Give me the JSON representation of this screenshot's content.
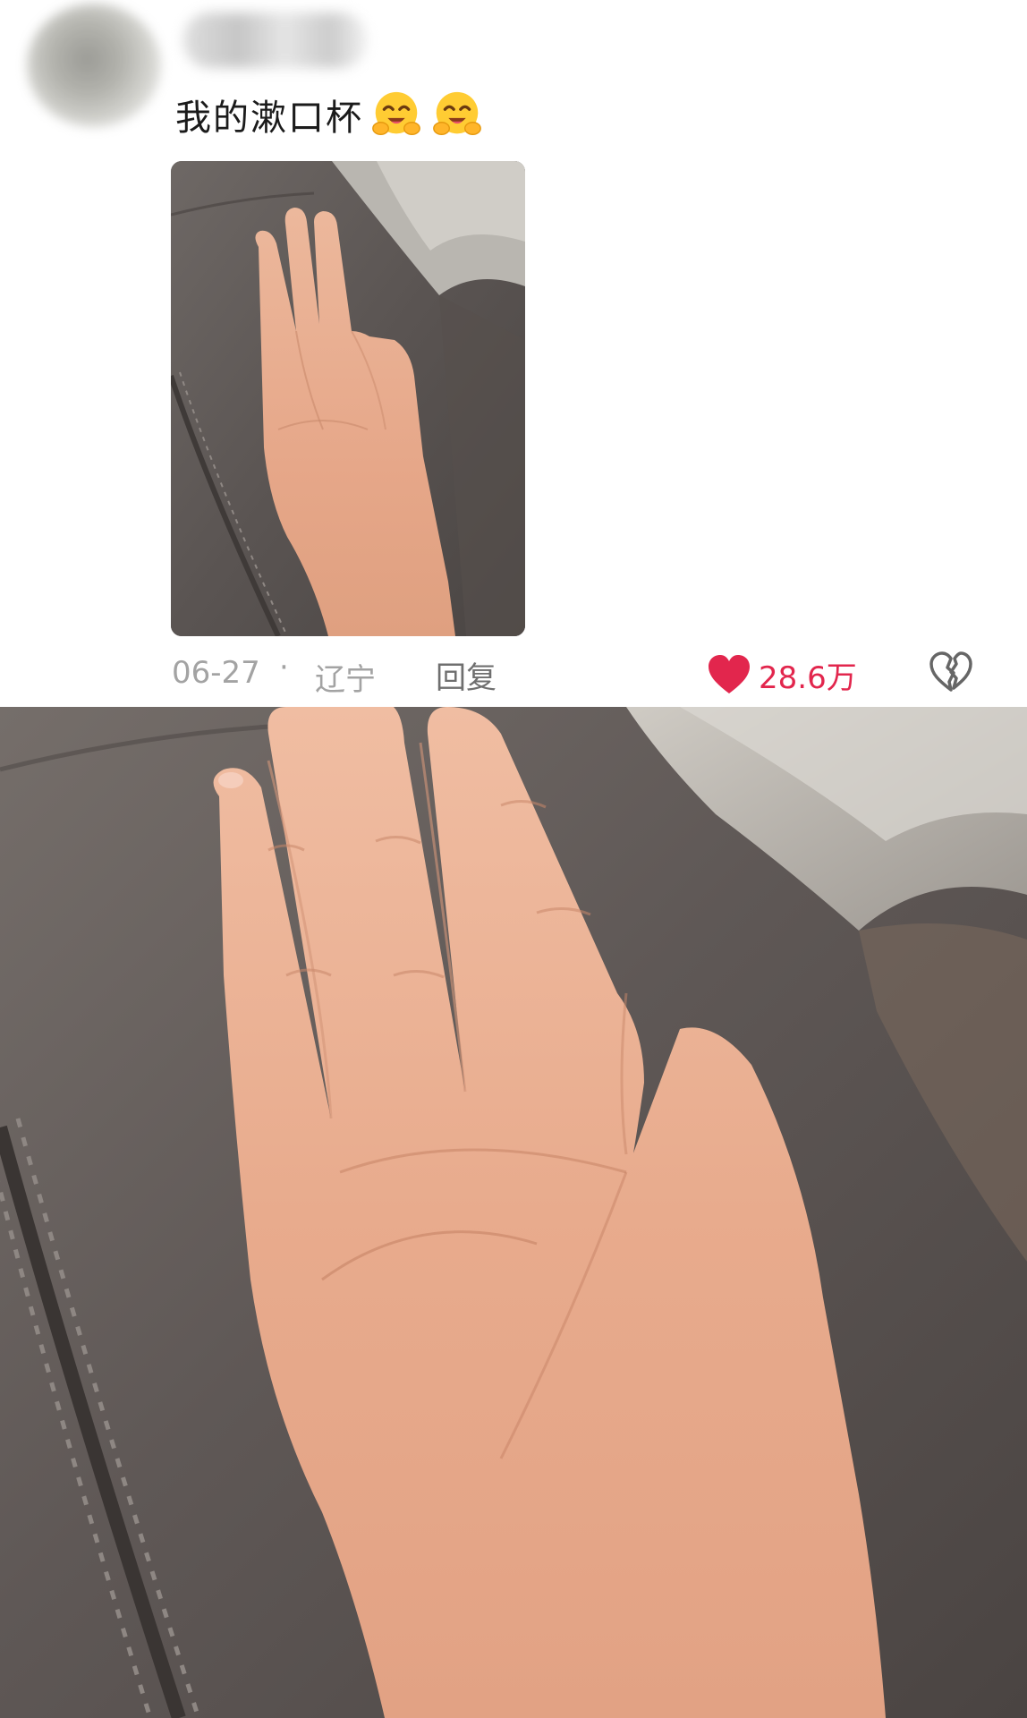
{
  "comment": {
    "username": "",
    "text": "我的漱口杯",
    "emojis": [
      "hugging-face-emoji",
      "hugging-face-emoji"
    ],
    "date": "06-27",
    "separator": "·",
    "location": "辽宁",
    "reply_label": "回复",
    "like_count": "28.6万"
  },
  "colors": {
    "like_red": "#e2264d",
    "meta_gray": "#a3a3a3",
    "text_dark": "#1b1b1b",
    "leather": "#5e5755",
    "skin": "#e8ad8e"
  },
  "icons": {
    "like": "heart-icon",
    "dislike": "broken-heart-icon"
  }
}
